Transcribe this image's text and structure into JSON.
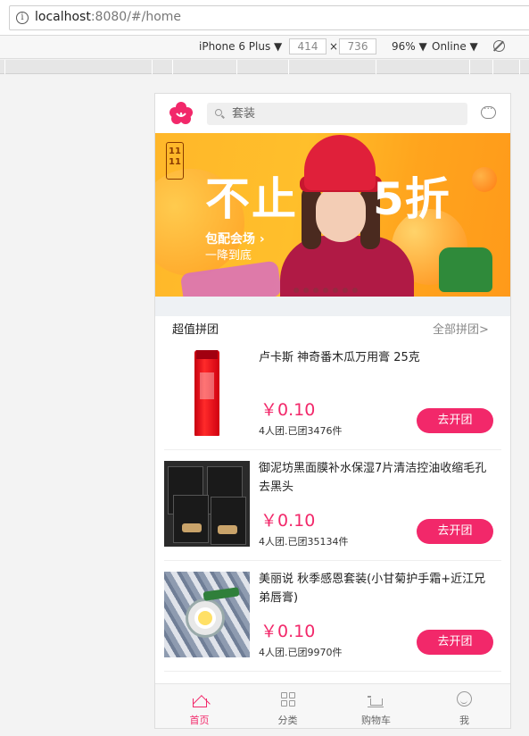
{
  "browser": {
    "url_host": "localhost",
    "url_rest": ":8080/#/home",
    "device": "iPhone 6 Plus",
    "width": "414",
    "height": "736",
    "zoom": "96%",
    "network": "Online",
    "times": "×",
    "caret": "▼"
  },
  "header": {
    "search_placeholder": "套装"
  },
  "banner": {
    "badge": "11 11",
    "headline_left": "不止",
    "headline_right": "5折",
    "sub_line1": "包配会场 ›",
    "sub_line2": "一降到底",
    "slide_count": 7
  },
  "section": {
    "title": "超值拼团",
    "more": "全部拼团>"
  },
  "products": [
    {
      "name": "卢卡斯 神奇番木瓜万用膏 25克",
      "price": "￥0.10",
      "meta": "4人团.已团3476件",
      "button": "去开团"
    },
    {
      "name": "御泥坊黑面膜补水保湿7片清洁控油收缩毛孔去黑头",
      "price": "￥0.10",
      "meta": "4人团.已团35134件",
      "button": "去开团"
    },
    {
      "name": "美丽说 秋季感恩套装(小甘菊护手霜+近江兄弟唇膏)",
      "price": "￥0.10",
      "meta": "4人团.已团9970件",
      "button": "去开团"
    }
  ],
  "tabs": [
    {
      "label": "首页",
      "icon": "home-icon"
    },
    {
      "label": "分类",
      "icon": "grid-icon"
    },
    {
      "label": "购物车",
      "icon": "cart-icon"
    },
    {
      "label": "我",
      "icon": "user-icon"
    }
  ],
  "colors": {
    "accent": "#f2286a",
    "banner": "#ffb72a"
  }
}
